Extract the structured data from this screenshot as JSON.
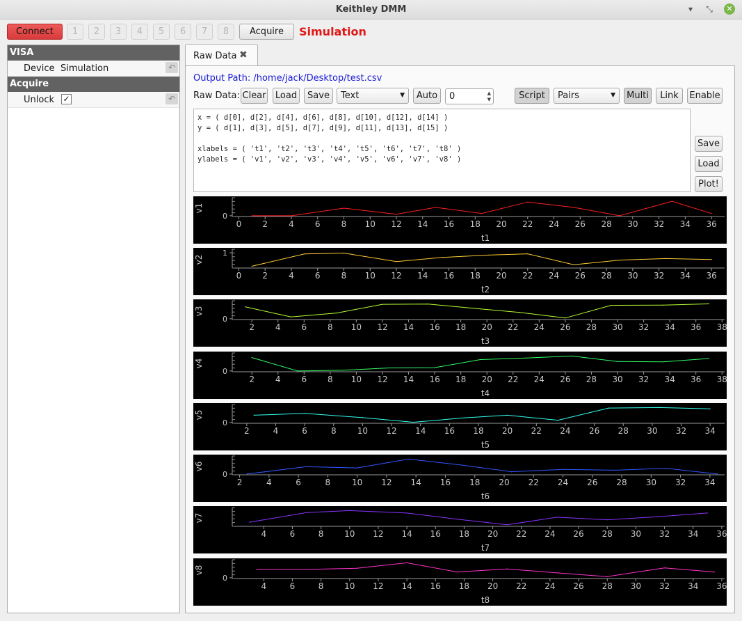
{
  "window": {
    "title": "Keithley DMM"
  },
  "toolbar": {
    "connect_label": "Connect",
    "channels": [
      "1",
      "2",
      "3",
      "4",
      "5",
      "6",
      "7",
      "8"
    ],
    "acquire_label": "Acquire",
    "status_text": "Simulation"
  },
  "sidebar": {
    "sections": [
      {
        "title": "VISA",
        "items": [
          {
            "name": "Device",
            "value": "Simulation"
          }
        ]
      },
      {
        "title": "Acquire",
        "items": [
          {
            "name": "Unlock",
            "checked": true,
            "check_glyph": "✓"
          }
        ]
      }
    ]
  },
  "tabs": [
    {
      "label": "Raw Data"
    }
  ],
  "raw": {
    "output_path": "Output Path: /home/jack/Desktop/test.csv",
    "raw_data_label": "Raw Data:",
    "clear_label": "Clear",
    "load_label": "Load",
    "save_label": "Save",
    "format_value": "Text",
    "auto_label": "Auto",
    "spin_value": "0",
    "script_label": "Script",
    "mode_value": "Pairs",
    "multi_label": "Multi",
    "link_label": "Link",
    "enable_label": "Enable",
    "script_lines": [
      "x = ( d[0], d[2], d[4], d[6], d[8], d[10], d[12], d[14] )",
      "y = ( d[1], d[3], d[5], d[7], d[9], d[11], d[13], d[15] )",
      "",
      "xlabels = ( 't1', 't2', 't3', 't4', 't5', 't6', 't7', 't8' )",
      "ylabels = ( 'v1', 'v2', 'v3', 'v4', 'v5', 'v6', 'v7', 'v8' )"
    ],
    "script_save_label": "Save",
    "script_load_label": "Load",
    "plot_label": "Plot!"
  },
  "chart_data": [
    {
      "type": "line",
      "xlabel": "t1",
      "ylabel": "v1",
      "color": "#ff2020",
      "xlim": [
        -0.5,
        37
      ],
      "x_ticks": [
        0,
        2,
        4,
        6,
        8,
        10,
        12,
        14,
        16,
        18,
        20,
        22,
        24,
        26,
        28,
        30,
        32,
        34,
        36
      ],
      "y_ticks": [
        {
          "label": "0",
          "value": 0
        }
      ],
      "ylim": [
        -0.05,
        1
      ],
      "x": [
        1,
        4,
        8,
        12,
        15,
        18.5,
        22,
        25.5,
        29,
        33,
        36
      ],
      "y": [
        0,
        0,
        0.5,
        0.1,
        0.55,
        0.15,
        0.9,
        0.55,
        0,
        0.95,
        0.15
      ]
    },
    {
      "type": "line",
      "xlabel": "t2",
      "ylabel": "v2",
      "color": "#ffcc33",
      "xlim": [
        -0.5,
        37
      ],
      "x_ticks": [
        0,
        2,
        4,
        6,
        8,
        10,
        12,
        14,
        16,
        18,
        20,
        22,
        24,
        26,
        28,
        30,
        32,
        34,
        36
      ],
      "y_ticks": [
        {
          "label": "1",
          "value": 1
        }
      ],
      "ylim": [
        0,
        1.05
      ],
      "x": [
        1,
        5,
        8,
        12,
        15.5,
        19,
        22,
        25.5,
        29,
        32.5,
        36
      ],
      "y": [
        0.12,
        0.92,
        0.98,
        0.42,
        0.7,
        0.85,
        0.93,
        0.22,
        0.52,
        0.62,
        0.56
      ]
    },
    {
      "type": "line",
      "xlabel": "t3",
      "ylabel": "v3",
      "color": "#b8ff33",
      "xlim": [
        0.5,
        38.2
      ],
      "x_ticks": [
        2,
        4,
        6,
        8,
        10,
        12,
        14,
        16,
        18,
        20,
        22,
        24,
        26,
        28,
        30,
        32,
        34,
        36,
        38
      ],
      "y_ticks": [
        {
          "label": "0",
          "value": 0
        }
      ],
      "ylim": [
        -0.05,
        1
      ],
      "x": [
        1.5,
        5,
        8.5,
        12,
        15.5,
        19.5,
        22.5,
        26,
        29.5,
        33.5,
        37
      ],
      "y": [
        0.78,
        0.12,
        0.38,
        0.95,
        0.97,
        0.65,
        0.42,
        0.05,
        0.88,
        0.9,
        0.98
      ]
    },
    {
      "type": "line",
      "xlabel": "t4",
      "ylabel": "v4",
      "color": "#33ff66",
      "xlim": [
        0.5,
        38.2
      ],
      "x_ticks": [
        2,
        4,
        6,
        8,
        10,
        12,
        14,
        16,
        18,
        20,
        22,
        24,
        26,
        28,
        30,
        32,
        34,
        36,
        38
      ],
      "y_ticks": [
        {
          "label": "0",
          "value": 0
        }
      ],
      "ylim": [
        -0.05,
        1
      ],
      "x": [
        2,
        5.5,
        9,
        12.5,
        16,
        19.5,
        23,
        26.5,
        30,
        33.5,
        37
      ],
      "y": [
        0.88,
        0,
        0.05,
        0.2,
        0.22,
        0.75,
        0.85,
        0.98,
        0.62,
        0.6,
        0.82
      ]
    },
    {
      "type": "line",
      "xlabel": "t5",
      "ylabel": "v5",
      "color": "#33ffee",
      "xlim": [
        1,
        35
      ],
      "x_ticks": [
        2,
        4,
        6,
        8,
        10,
        12,
        14,
        16,
        18,
        20,
        22,
        24,
        26,
        28,
        30,
        32,
        34
      ],
      "y_ticks": [
        {
          "label": "0",
          "value": 0
        }
      ],
      "ylim": [
        -0.05,
        1
      ],
      "x": [
        2.5,
        6,
        10,
        13.5,
        17,
        20,
        23.5,
        27,
        30.5,
        34
      ],
      "y": [
        0.48,
        0.6,
        0.32,
        0.02,
        0.3,
        0.48,
        0.15,
        0.95,
        0.98,
        0.9
      ]
    },
    {
      "type": "line",
      "xlabel": "t6",
      "ylabel": "v6",
      "color": "#3355ff",
      "xlim": [
        1.5,
        35
      ],
      "x_ticks": [
        2,
        4,
        6,
        8,
        10,
        12,
        14,
        16,
        18,
        20,
        22,
        24,
        26,
        28,
        30,
        32,
        34
      ],
      "y_ticks": [
        {
          "label": "0",
          "value": 0
        }
      ],
      "ylim": [
        -0.05,
        1
      ],
      "x": [
        2.5,
        6.5,
        10,
        13.5,
        17,
        20.5,
        24,
        27.5,
        31,
        34.5
      ],
      "y": [
        0,
        0.48,
        0.4,
        0.98,
        0.6,
        0.15,
        0.3,
        0.25,
        0.38,
        0
      ]
    },
    {
      "type": "line",
      "xlabel": "t7",
      "ylabel": "v7",
      "color": "#8a33ff",
      "xlim": [
        1.8,
        36.2
      ],
      "x_ticks": [
        4,
        6,
        8,
        10,
        12,
        14,
        16,
        18,
        20,
        22,
        24,
        26,
        28,
        30,
        32,
        34,
        36
      ],
      "y_ticks": [],
      "ylim": [
        -0.05,
        1
      ],
      "x": [
        3,
        7,
        10,
        14,
        17.5,
        21,
        24.5,
        28,
        31.5,
        35
      ],
      "y": [
        0.22,
        0.85,
        0.98,
        0.82,
        0.42,
        0.05,
        0.55,
        0.38,
        0.58,
        0.82
      ]
    },
    {
      "type": "line",
      "xlabel": "t8",
      "ylabel": "v8",
      "color": "#ff33cc",
      "xlim": [
        1.8,
        36.2
      ],
      "x_ticks": [
        4,
        6,
        8,
        10,
        12,
        14,
        16,
        18,
        20,
        22,
        24,
        26,
        28,
        30,
        32,
        34,
        36
      ],
      "y_ticks": [
        {
          "label": "0",
          "value": 0
        }
      ],
      "ylim": [
        -0.05,
        1
      ],
      "x": [
        3.5,
        7,
        10.5,
        14,
        17.5,
        21,
        24.5,
        28,
        32,
        35.5
      ],
      "y": [
        0.55,
        0.55,
        0.62,
        0.98,
        0.38,
        0.58,
        0.32,
        0.08,
        0.65,
        0.38
      ]
    }
  ]
}
